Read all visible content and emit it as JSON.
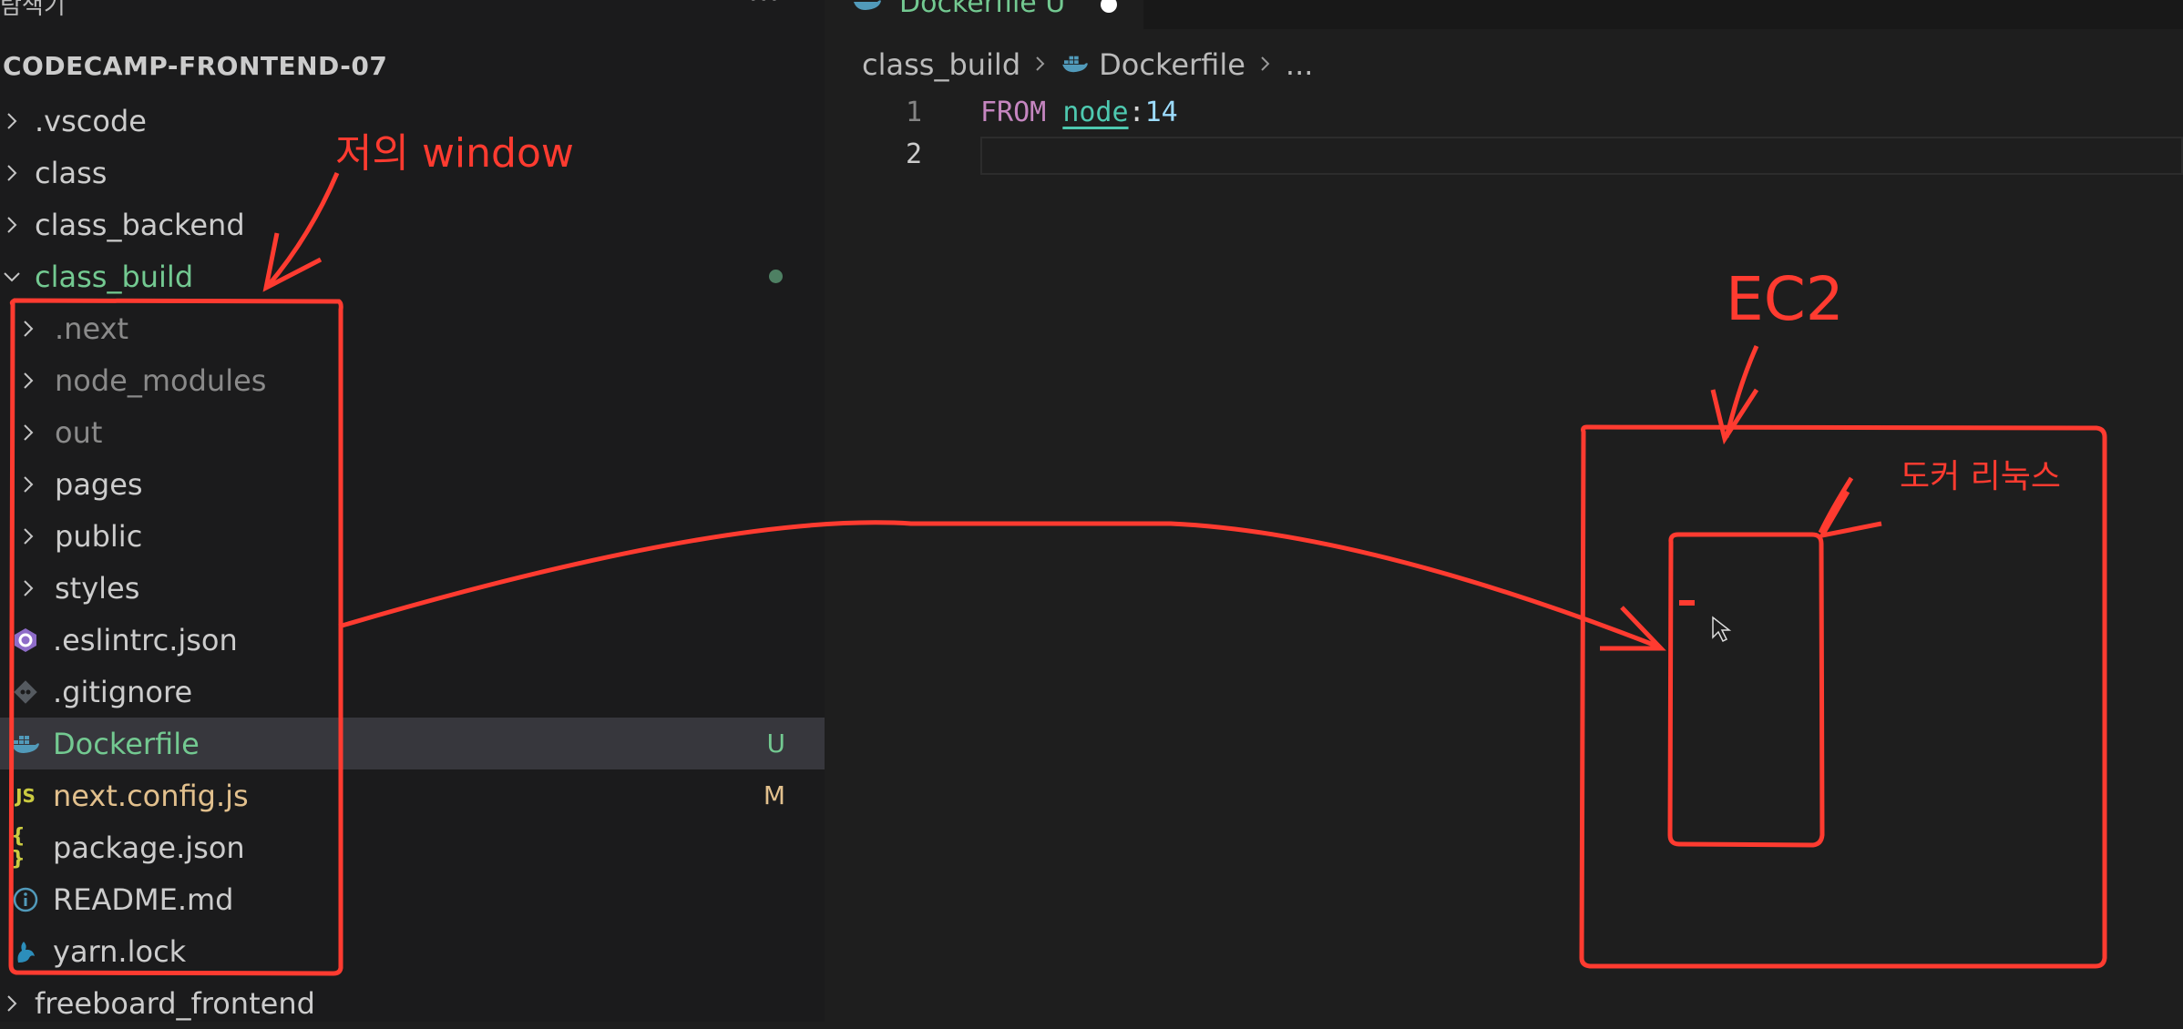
{
  "sidebar": {
    "title": "탐색기",
    "more": "···",
    "workspace": "CODECAMP-FRONTEND-07",
    "items": [
      {
        "label": ".vscode"
      },
      {
        "label": "class"
      },
      {
        "label": "class_backend"
      },
      {
        "label": "class_build"
      },
      {
        "label": ".next"
      },
      {
        "label": "node_modules"
      },
      {
        "label": "out"
      },
      {
        "label": "pages"
      },
      {
        "label": "public"
      },
      {
        "label": "styles"
      },
      {
        "label": ".eslintrc.json"
      },
      {
        "label": ".gitignore"
      },
      {
        "label": "Dockerfile",
        "badge": "U"
      },
      {
        "label": "next.config.js",
        "badge": "M",
        "icon_text": "JS"
      },
      {
        "label": "package.json",
        "icon_text": "{ }"
      },
      {
        "label": "README.md",
        "icon_text": "i"
      },
      {
        "label": "yarn.lock"
      },
      {
        "label": "freeboard_frontend"
      }
    ]
  },
  "editor": {
    "tab": {
      "label": "Dockerfile U"
    },
    "breadcrumb": [
      "class_build",
      "Dockerfile",
      "..."
    ],
    "lines": [
      {
        "number": "1",
        "keyword": "FROM",
        "image": "node",
        "sep": ":",
        "tag": "14"
      },
      {
        "number": "2"
      }
    ]
  },
  "annotations": {
    "my_window": "저의 window",
    "ec2": "EC2",
    "docker_linux": "도커 리눅스",
    "color": "#ff3b30"
  },
  "colors": {
    "untracked": "#73c991",
    "modified": "#e2c08d",
    "annotation": "#ff3b30",
    "selection": "#37373d"
  }
}
